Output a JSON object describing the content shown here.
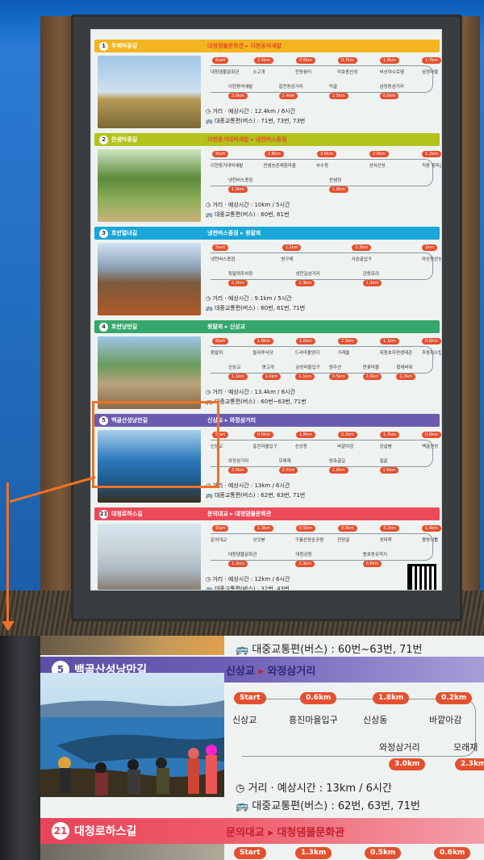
{
  "colors": {
    "band1": "#f2b51f",
    "band2": "#b3c31c",
    "band3": "#1aa6d8",
    "band4": "#36a76c",
    "band5": "#6b5bb0",
    "band21": "#ec4a5a",
    "pill": "#e4502f",
    "callout": "#f07125"
  },
  "sections": [
    {
      "num": "1",
      "name": "두메마중길",
      "from": "대청댐물문화관",
      "to": "이현동억새밭",
      "pills_top": [
        "Start",
        "2.5km",
        "0.6km",
        "0.7km",
        "1.8km",
        "1.7km"
      ],
      "stops_top": [
        "대청댐물문화관",
        "소고개",
        "전망쉼터",
        "미호동산성",
        "비상여수로댐",
        "삼정마을"
      ],
      "stops_bottom": [
        "이현동억새밭",
        "갈전동삼거리",
        "덕골",
        "삼정동삼거리"
      ],
      "pills_bottom": [
        "2.0km",
        "2.4km",
        "1.5km",
        "0.5km"
      ],
      "distance": "거리 · 예상시간 : 12.4km / 6시간",
      "bus": "대중교통편(버스) : 71번, 73번, 73번"
    },
    {
      "num": "2",
      "name": "찬샘마중길",
      "from": "이현동거대억새밭",
      "to": "냉천버스종점",
      "pills_top": [
        "Start",
        "1.8km",
        "3.0km",
        "2.0km",
        "1.2km"
      ],
      "stops_top": [
        "이현동거대억새밭",
        "찬샘농촌체험마을",
        "부수동",
        "성치산성",
        "직동 윗피골"
      ],
      "stops_bottom": [
        "냉천버스종점",
        "찬샘정"
      ],
      "pills_bottom": [
        "1.0km",
        "1.0km"
      ],
      "distance": "거리 · 예상시간 : 10km / 5시간",
      "bus": "대중교통편(버스) : 60번, 61번"
    },
    {
      "num": "3",
      "name": "호반열녀길",
      "from": "냉천버스종점",
      "to": "윗말뫼",
      "pills_top": [
        "Start",
        "1.2km",
        "1.3km",
        "1km"
      ],
      "stops_top": [
        "냉천버스종점",
        "방구레",
        "사슴골입구",
        "마산동산성"
      ],
      "stops_bottom": [
        "윗말뫼주차장",
        "냉천길삼거리",
        "관동묘려"
      ],
      "pills_bottom": [
        "2.2km",
        "1.3km",
        "1.3km"
      ],
      "distance": "거리 · 예상시간 : 9.1km / 5시간",
      "bus": "대중교통편(버스) : 60번, 61번, 71번"
    },
    {
      "num": "4",
      "name": "호반낭만길",
      "from": "윗말뫼",
      "to": "신상교",
      "pills_top": [
        "Start",
        "1.8km",
        "1.6km",
        "2.5km",
        "1.1km",
        "0.6km"
      ],
      "stops_top": [
        "윗말뫼",
        "들마루식당",
        "드라마촬영지",
        "가래울",
        "대청호자연생태관",
        "추동취수탑"
      ],
      "stops_bottom": [
        "신상교",
        "명고개",
        "금성마을입구",
        "원주산",
        "연꽃마을",
        "황새바위"
      ],
      "pills_bottom": [
        "1.1km",
        "1.0km",
        "1.1km",
        "0.5km",
        "2.0km",
        "1.7km"
      ],
      "distance": "거리 · 예상시간 : 13.4km / 6시간",
      "bus": "대중교통편(버스) : 60번~63번, 71번"
    },
    {
      "num": "5",
      "name": "백골산성낭만길",
      "from": "신상교",
      "to": "와정삼거리",
      "pills_top": [
        "Start",
        "0.6km",
        "1.8km",
        "0.2km",
        "1.7km",
        "0.6km"
      ],
      "stops_top": [
        "신상교",
        "흥진마을입구",
        "신상동",
        "바깥아감",
        "강살봉",
        "백골산성"
      ],
      "stops_bottom": [
        "와정삼거리",
        "모래재",
        "방축골길",
        "절골"
      ],
      "pills_bottom": [
        "3.0km",
        "2.3km",
        "1.8km",
        "1.6km"
      ],
      "distance": "거리 · 예상시간 : 13km / 6시간",
      "bus": "대중교통편(버스) : 62번, 63번, 71번"
    },
    {
      "num": "21",
      "name": "대청로하스길",
      "from": "문의대교",
      "to": "대청댐물문화관",
      "pills_top": [
        "Start",
        "1.3km",
        "0.5km",
        "0.6km",
        "3.2km",
        "1.4km"
      ],
      "stops_top": [
        "문의대교",
        "삿갓봉",
        "구룡산장승공원",
        "진장골",
        "성마루",
        "용방이틀"
      ],
      "stops_bottom": [
        "대청댐물문화관",
        "대청공원",
        "용호동유적지"
      ],
      "pills_bottom": [
        "1.3km",
        "3.3km",
        "0.8km"
      ],
      "distance": "거리 · 예상시간 : 12km / 6시간",
      "bus": "대중교통편(버스) : 32번, 43번"
    }
  ],
  "zoom": {
    "prev_bus": "대중교통편(버스) : 60번~63번, 71번",
    "num": "5",
    "name": "백골산성낭만길",
    "from": "신상교",
    "to": "와정삼거리",
    "pills_top": [
      "Start",
      "0.6km",
      "1.8km",
      "0.2km"
    ],
    "stops_top": [
      "신상교",
      "흥진마을입구",
      "신상동",
      "바깥아감"
    ],
    "stops_bottom": [
      "와정삼거리",
      "모래재"
    ],
    "pills_bottom": [
      "3.0km",
      "2.3km"
    ],
    "distance": "거리 · 예상시간 : 13km / 6시간",
    "bus": "대중교통편(버스) : 62번, 63번, 71번",
    "next_num": "21",
    "next_name": "대청로하스길",
    "next_from": "문의대교",
    "next_to": "대청댐물문화관",
    "next_pills": [
      "Start",
      "1.3km",
      "0.5km",
      "0.6km"
    ]
  }
}
